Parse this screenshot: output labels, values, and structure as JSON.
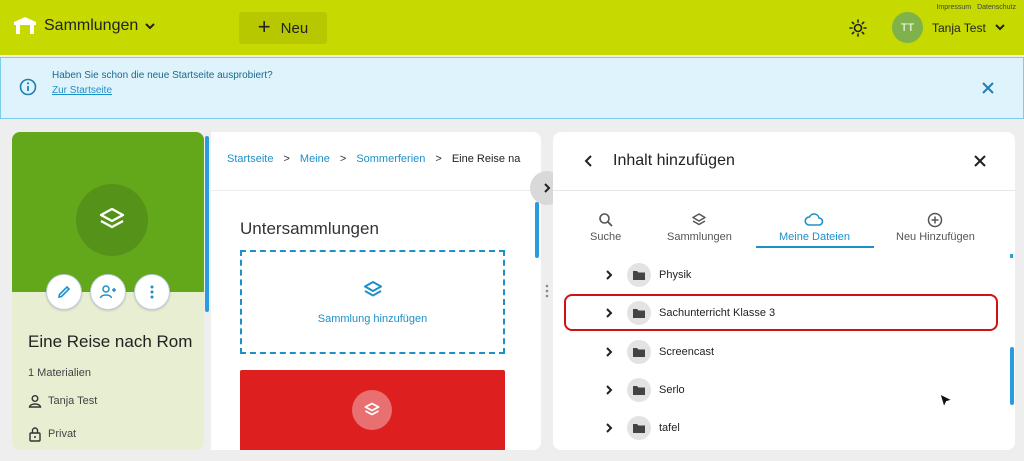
{
  "topbar": {
    "brand_label": "Sammlungen",
    "new_button_label": "Neu",
    "links": [
      "Impressum",
      "Datenschutz"
    ],
    "user_initials": "TT",
    "user_name": "Tanja Test",
    "colors": {
      "bar": "#c6d900",
      "new_button": "#b7c700"
    }
  },
  "banner": {
    "text": "Haben Sie schon die neue Startseite ausprobiert?",
    "link": "Zur Startseite"
  },
  "collection": {
    "title": "Eine Reise nach Rom",
    "materials": "1 Materialien",
    "owner": "Tanja Test",
    "visibility": "Privat",
    "colors": {
      "hero": "#63a81b"
    }
  },
  "breadcrumb": {
    "items": [
      "Startseite",
      "Meine",
      "Sommerferien"
    ],
    "current": "Eine Reise na"
  },
  "subcollections": {
    "title": "Untersammlungen",
    "add_label": "Sammlung hinzufügen"
  },
  "add_panel": {
    "title": "Inhalt hinzufügen",
    "tabs": [
      {
        "label": "Suche",
        "icon": "search-icon"
      },
      {
        "label": "Sammlungen",
        "icon": "layers-icon"
      },
      {
        "label": "Meine Dateien",
        "icon": "cloud-icon",
        "active": true
      },
      {
        "label": "Neu Hinzufügen",
        "icon": "add-circle-icon"
      }
    ],
    "folders": [
      "Physik",
      "Sachunterricht Klasse 3",
      "Screencast",
      "Serlo",
      "tafel"
    ],
    "highlighted_folder": "Sachunterricht Klasse 3",
    "colors": {
      "accent": "#1e90c8",
      "highlight": "#cc1414"
    }
  }
}
